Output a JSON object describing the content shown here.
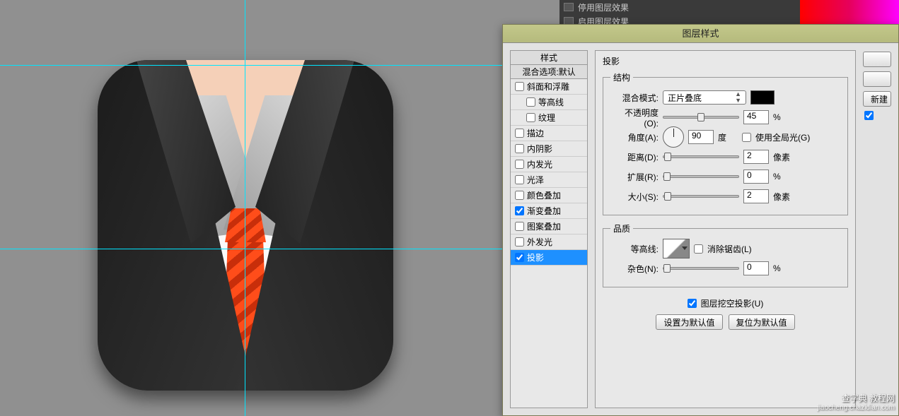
{
  "top_panel": {
    "row1": "停用图层效果",
    "row2": "启用图层效果"
  },
  "dialog": {
    "title": "图层样式",
    "styles_header": "样式",
    "blending_default": "混合选项:默认",
    "styles": [
      {
        "label": "斜面和浮雕",
        "checked": false,
        "indent": false
      },
      {
        "label": "等高线",
        "checked": false,
        "indent": true
      },
      {
        "label": "纹理",
        "checked": false,
        "indent": true
      },
      {
        "label": "描边",
        "checked": false,
        "indent": false
      },
      {
        "label": "内阴影",
        "checked": false,
        "indent": false
      },
      {
        "label": "内发光",
        "checked": false,
        "indent": false
      },
      {
        "label": "光泽",
        "checked": false,
        "indent": false
      },
      {
        "label": "颜色叠加",
        "checked": false,
        "indent": false
      },
      {
        "label": "渐变叠加",
        "checked": true,
        "indent": false
      },
      {
        "label": "图案叠加",
        "checked": false,
        "indent": false
      },
      {
        "label": "外发光",
        "checked": false,
        "indent": false
      },
      {
        "label": "投影",
        "checked": true,
        "indent": false,
        "selected": true
      }
    ],
    "section_title": "投影",
    "structure_legend": "结构",
    "blend_mode_label": "混合模式:",
    "blend_mode_value": "正片叠底",
    "opacity_label": "不透明度(O):",
    "opacity_value": "45",
    "opacity_unit": "%",
    "angle_label": "角度(A):",
    "angle_value": "90",
    "angle_unit": "度",
    "global_light_label": "使用全局光(G)",
    "distance_label": "距离(D):",
    "distance_value": "2",
    "distance_unit": "像素",
    "spread_label": "扩展(R):",
    "spread_value": "0",
    "spread_unit": "%",
    "size_label": "大小(S):",
    "size_value": "2",
    "size_unit": "像素",
    "quality_legend": "品质",
    "contour_label": "等高线:",
    "antialias_label": "消除锯齿(L)",
    "noise_label": "杂色(N):",
    "noise_value": "0",
    "noise_unit": "%",
    "knockout_label": "图层挖空投影(U)",
    "set_default_btn": "设置为默认值",
    "reset_default_btn": "复位为默认值",
    "right_buttons": {
      "new": "新建"
    }
  },
  "watermark": {
    "line1": "查字典 教程网",
    "line2": "jiaocheng.chazidian.com"
  }
}
